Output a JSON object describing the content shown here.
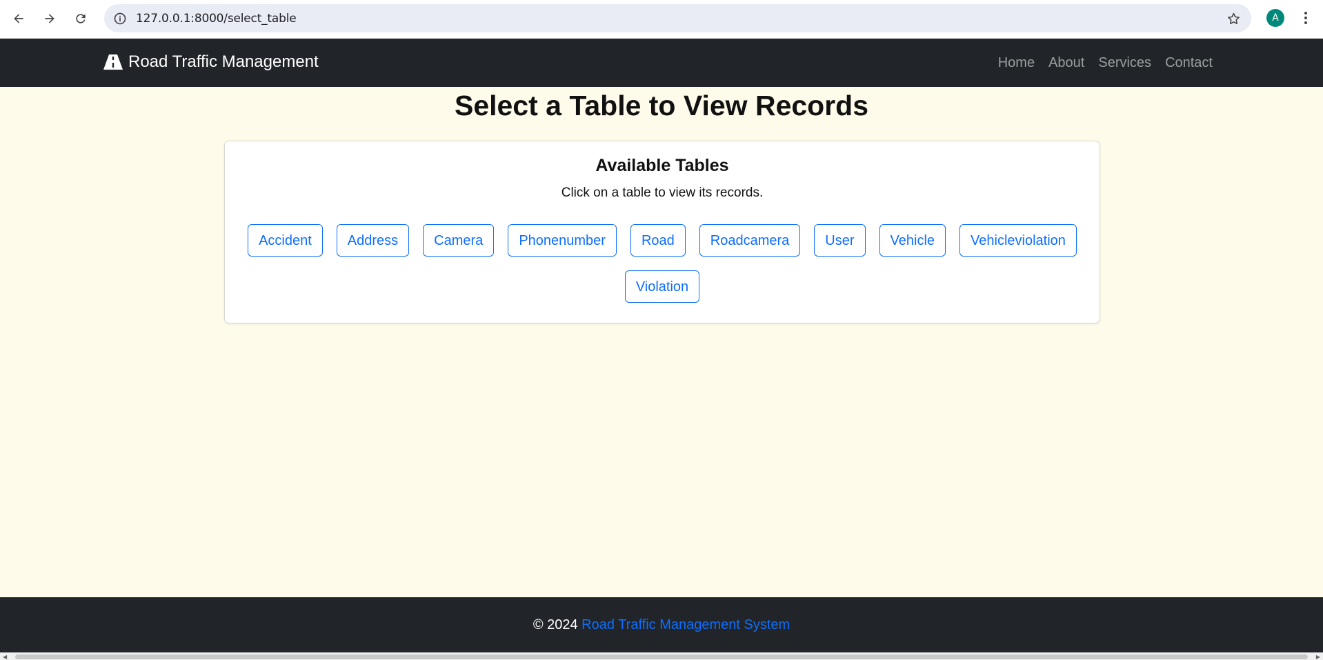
{
  "browser": {
    "url": "127.0.0.1:8000/select_table",
    "profile_initial": "A"
  },
  "navbar": {
    "brand": "Road Traffic Management",
    "links": [
      {
        "label": "Home"
      },
      {
        "label": "About"
      },
      {
        "label": "Services"
      },
      {
        "label": "Contact"
      }
    ]
  },
  "main": {
    "title": "Select a Table to View Records",
    "card": {
      "title": "Available Tables",
      "subtitle": "Click on a table to view its records.",
      "tables": [
        "Accident",
        "Address",
        "Camera",
        "Phonenumber",
        "Road",
        "Roadcamera",
        "User",
        "Vehicle",
        "Vehicleviolation",
        "Violation"
      ]
    }
  },
  "footer": {
    "copyright": "© 2024",
    "link_text": "Road Traffic Management System"
  },
  "colors": {
    "page_bg": "#fffbea",
    "navbar_bg": "#212529",
    "accent": "#0d6efd"
  }
}
